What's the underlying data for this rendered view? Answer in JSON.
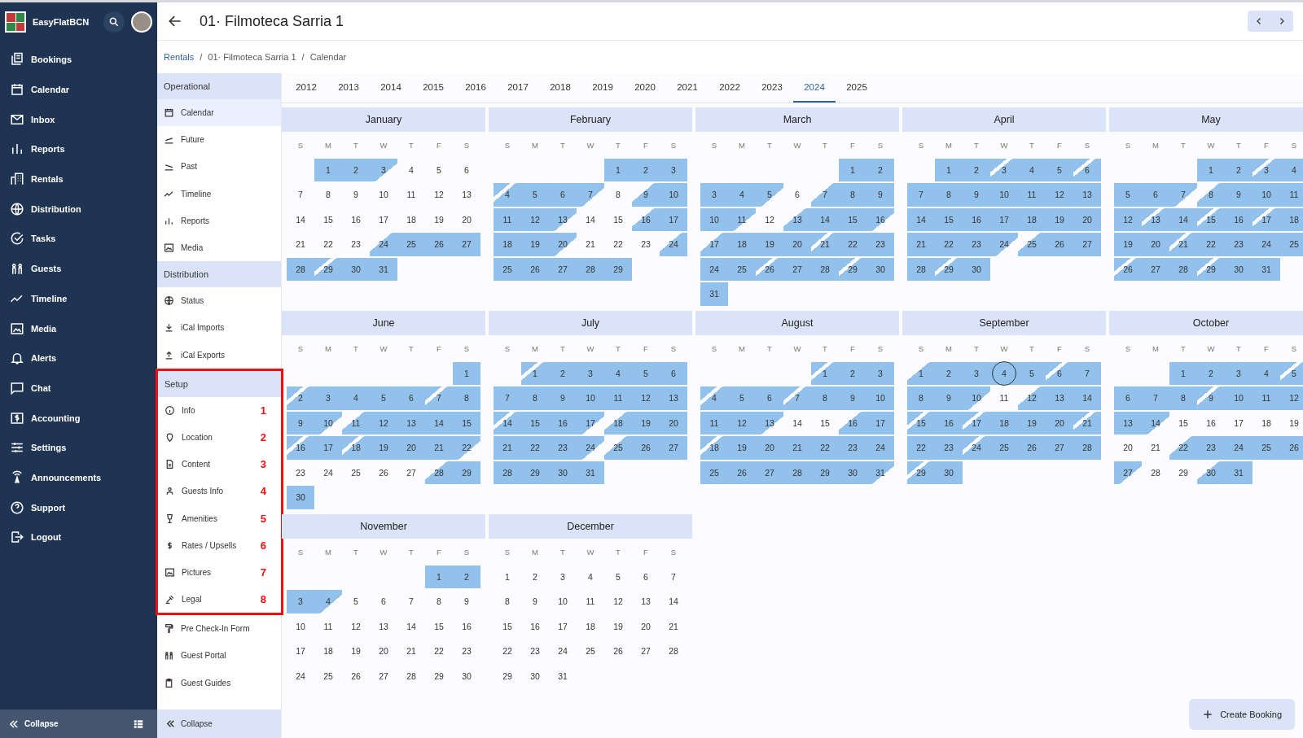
{
  "app": {
    "name": "EasyFlatBCN"
  },
  "header": {
    "title": "01· Filmoteca Sarria 1"
  },
  "breadcrumb": [
    {
      "label": "Rentals",
      "link": true,
      "separator": "/"
    },
    {
      "label": "01· Filmoteca Sarria 1",
      "link": false,
      "separator": "/"
    },
    {
      "label": "Calendar",
      "link": false
    }
  ],
  "main_nav": {
    "items": [
      {
        "label": "Bookings"
      },
      {
        "label": "Calendar"
      },
      {
        "label": "Inbox"
      },
      {
        "label": "Reports"
      },
      {
        "label": "Rentals"
      },
      {
        "label": "Distribution"
      },
      {
        "label": "Tasks"
      },
      {
        "label": "Guests"
      },
      {
        "label": "Timeline"
      },
      {
        "label": "Media"
      },
      {
        "label": "Alerts"
      },
      {
        "label": "Chat"
      },
      {
        "label": "Accounting"
      },
      {
        "label": "Settings"
      },
      {
        "label": "Announcements"
      },
      {
        "label": "Support"
      },
      {
        "label": "Logout"
      }
    ],
    "collapse": "Collapse"
  },
  "sub_nav": {
    "sections": [
      {
        "title": "Operational",
        "annotated": false,
        "items": [
          {
            "label": "Calendar",
            "selected": true
          },
          {
            "label": "Future",
            "selected": false
          },
          {
            "label": "Past",
            "selected": false
          },
          {
            "label": "Timeline",
            "selected": false
          },
          {
            "label": "Reports",
            "selected": false
          },
          {
            "label": "Media",
            "selected": false
          }
        ]
      },
      {
        "title": "Distribution",
        "annotated": false,
        "items": [
          {
            "label": "Status",
            "selected": false
          },
          {
            "label": "iCal Imports",
            "selected": false
          },
          {
            "label": "iCal Exports",
            "selected": false
          }
        ]
      },
      {
        "title": "Setup",
        "annotated": true,
        "items": [
          {
            "label": "Info",
            "selected": false,
            "marker": "1"
          },
          {
            "label": "Location",
            "selected": false,
            "marker": "2"
          },
          {
            "label": "Content",
            "selected": false,
            "marker": "3"
          },
          {
            "label": "Guests Info",
            "selected": false,
            "marker": "4"
          },
          {
            "label": "Amenities",
            "selected": false,
            "marker": "5"
          },
          {
            "label": "Rates / Upsells",
            "selected": false,
            "marker": "6"
          },
          {
            "label": "Pictures",
            "selected": false,
            "marker": "7"
          },
          {
            "label": "Legal",
            "selected": false,
            "marker": "8"
          }
        ]
      },
      {
        "annotated": false,
        "items": [
          {
            "label": "Pre Check-In Form",
            "selected": false
          },
          {
            "label": "Guest Portal",
            "selected": false
          },
          {
            "label": "Guest Guides",
            "selected": false
          }
        ]
      }
    ],
    "collapse": "Collapse"
  },
  "years": [
    {
      "label": "2012",
      "selected": false
    },
    {
      "label": "2013",
      "selected": false
    },
    {
      "label": "2014",
      "selected": false
    },
    {
      "label": "2015",
      "selected": false
    },
    {
      "label": "2016",
      "selected": false
    },
    {
      "label": "2017",
      "selected": false
    },
    {
      "label": "2018",
      "selected": false
    },
    {
      "label": "2019",
      "selected": false
    },
    {
      "label": "2020",
      "selected": false
    },
    {
      "label": "2021",
      "selected": false
    },
    {
      "label": "2022",
      "selected": false
    },
    {
      "label": "2023",
      "selected": false
    },
    {
      "label": "2024",
      "selected": true
    },
    {
      "label": "2025",
      "selected": false
    }
  ],
  "calendar": {
    "months": [
      {
        "name": "January",
        "weekdays": [
          "S",
          "M",
          "T",
          "W",
          "T",
          "F",
          "S"
        ],
        "days": [
          {
            "day": "1",
            "kind": "full"
          },
          {
            "day": "2",
            "kind": "full"
          },
          {
            "day": "3",
            "kind": "out"
          },
          {
            "day": "4",
            "kind": "free"
          },
          {
            "day": "5",
            "kind": "free"
          },
          {
            "day": "6",
            "kind": "free"
          },
          {
            "day": "7",
            "kind": "free"
          },
          {
            "day": "8",
            "kind": "free"
          },
          {
            "day": "9",
            "kind": "free"
          },
          {
            "day": "10",
            "kind": "free"
          },
          {
            "day": "11",
            "kind": "free"
          },
          {
            "day": "12",
            "kind": "free"
          },
          {
            "day": "13",
            "kind": "free"
          },
          {
            "day": "14",
            "kind": "free"
          },
          {
            "day": "15",
            "kind": "free"
          },
          {
            "day": "16",
            "kind": "free"
          },
          {
            "day": "17",
            "kind": "free"
          },
          {
            "day": "18",
            "kind": "free"
          },
          {
            "day": "19",
            "kind": "free"
          },
          {
            "day": "20",
            "kind": "free"
          },
          {
            "day": "21",
            "kind": "free"
          },
          {
            "day": "22",
            "kind": "free"
          },
          {
            "day": "23",
            "kind": "free"
          },
          {
            "day": "24",
            "kind": "in"
          },
          {
            "day": "25",
            "kind": "full"
          },
          {
            "day": "26",
            "kind": "full"
          },
          {
            "day": "27",
            "kind": "full"
          },
          {
            "day": "28",
            "kind": "full"
          },
          {
            "day": "29",
            "kind": "swap"
          },
          {
            "day": "30",
            "kind": "full"
          },
          {
            "day": "31",
            "kind": "full"
          }
        ]
      },
      {
        "name": "February",
        "weekdays": [
          "S",
          "M",
          "T",
          "W",
          "T",
          "F",
          "S"
        ],
        "days": [
          {
            "day": "1",
            "kind": "full"
          },
          {
            "day": "2",
            "kind": "full"
          },
          {
            "day": "3",
            "kind": "full"
          },
          {
            "day": "4",
            "kind": "swap"
          },
          {
            "day": "5",
            "kind": "full"
          },
          {
            "day": "6",
            "kind": "full"
          },
          {
            "day": "7",
            "kind": "out"
          },
          {
            "day": "8",
            "kind": "free"
          },
          {
            "day": "9",
            "kind": "in"
          },
          {
            "day": "10",
            "kind": "full"
          },
          {
            "day": "11",
            "kind": "full"
          },
          {
            "day": "12",
            "kind": "full"
          },
          {
            "day": "13",
            "kind": "out"
          },
          {
            "day": "14",
            "kind": "free"
          },
          {
            "day": "15",
            "kind": "free"
          },
          {
            "day": "16",
            "kind": "in"
          },
          {
            "day": "17",
            "kind": "full"
          },
          {
            "day": "18",
            "kind": "full"
          },
          {
            "day": "19",
            "kind": "full"
          },
          {
            "day": "20",
            "kind": "out"
          },
          {
            "day": "21",
            "kind": "free"
          },
          {
            "day": "22",
            "kind": "free"
          },
          {
            "day": "23",
            "kind": "free"
          },
          {
            "day": "24",
            "kind": "in"
          },
          {
            "day": "25",
            "kind": "full"
          },
          {
            "day": "26",
            "kind": "full"
          },
          {
            "day": "27",
            "kind": "full"
          },
          {
            "day": "28",
            "kind": "full"
          },
          {
            "day": "29",
            "kind": "full"
          }
        ]
      },
      {
        "name": "March",
        "weekdays": [
          "S",
          "M",
          "T",
          "W",
          "T",
          "F",
          "S"
        ],
        "days": [
          {
            "day": "1",
            "kind": "full"
          },
          {
            "day": "2",
            "kind": "full"
          },
          {
            "day": "3",
            "kind": "full"
          },
          {
            "day": "4",
            "kind": "full"
          },
          {
            "day": "5",
            "kind": "out"
          },
          {
            "day": "6",
            "kind": "free"
          },
          {
            "day": "7",
            "kind": "in"
          },
          {
            "day": "8",
            "kind": "full"
          },
          {
            "day": "9",
            "kind": "full"
          },
          {
            "day": "10",
            "kind": "full"
          },
          {
            "day": "11",
            "kind": "out"
          },
          {
            "day": "12",
            "kind": "free"
          },
          {
            "day": "13",
            "kind": "in"
          },
          {
            "day": "14",
            "kind": "full"
          },
          {
            "day": "15",
            "kind": "full"
          },
          {
            "day": "16",
            "kind": "out"
          },
          {
            "day": "17",
            "kind": "in"
          },
          {
            "day": "18",
            "kind": "full"
          },
          {
            "day": "19",
            "kind": "full"
          },
          {
            "day": "20",
            "kind": "full"
          },
          {
            "day": "21",
            "kind": "swap"
          },
          {
            "day": "22",
            "kind": "full"
          },
          {
            "day": "23",
            "kind": "full"
          },
          {
            "day": "24",
            "kind": "full"
          },
          {
            "day": "25",
            "kind": "full"
          },
          {
            "day": "26",
            "kind": "swap"
          },
          {
            "day": "27",
            "kind": "full"
          },
          {
            "day": "28",
            "kind": "full"
          },
          {
            "day": "29",
            "kind": "swap"
          },
          {
            "day": "30",
            "kind": "full"
          },
          {
            "day": "31",
            "kind": "full"
          }
        ]
      },
      {
        "name": "April",
        "weekdays": [
          "S",
          "M",
          "T",
          "W",
          "T",
          "F",
          "S"
        ],
        "days": [
          {
            "day": "1",
            "kind": "full"
          },
          {
            "day": "2",
            "kind": "full"
          },
          {
            "day": "3",
            "kind": "swap"
          },
          {
            "day": "4",
            "kind": "full"
          },
          {
            "day": "5",
            "kind": "full"
          },
          {
            "day": "6",
            "kind": "swap"
          },
          {
            "day": "7",
            "kind": "full"
          },
          {
            "day": "8",
            "kind": "full"
          },
          {
            "day": "9",
            "kind": "full"
          },
          {
            "day": "10",
            "kind": "full"
          },
          {
            "day": "11",
            "kind": "full"
          },
          {
            "day": "12",
            "kind": "full"
          },
          {
            "day": "13",
            "kind": "full"
          },
          {
            "day": "14",
            "kind": "full"
          },
          {
            "day": "15",
            "kind": "full"
          },
          {
            "day": "16",
            "kind": "full"
          },
          {
            "day": "17",
            "kind": "full"
          },
          {
            "day": "18",
            "kind": "full"
          },
          {
            "day": "19",
            "kind": "full"
          },
          {
            "day": "20",
            "kind": "full"
          },
          {
            "day": "21",
            "kind": "full"
          },
          {
            "day": "22",
            "kind": "full"
          },
          {
            "day": "23",
            "kind": "full"
          },
          {
            "day": "24",
            "kind": "out"
          },
          {
            "day": "25",
            "kind": "in"
          },
          {
            "day": "26",
            "kind": "full"
          },
          {
            "day": "27",
            "kind": "full"
          },
          {
            "day": "28",
            "kind": "full"
          },
          {
            "day": "29",
            "kind": "swap"
          },
          {
            "day": "30",
            "kind": "full"
          }
        ]
      },
      {
        "name": "May",
        "weekdays": [
          "S",
          "M",
          "T",
          "W",
          "T",
          "F",
          "S"
        ],
        "days": [
          {
            "day": "1",
            "kind": "full"
          },
          {
            "day": "2",
            "kind": "full"
          },
          {
            "day": "3",
            "kind": "swap"
          },
          {
            "day": "4",
            "kind": "full"
          },
          {
            "day": "5",
            "kind": "full"
          },
          {
            "day": "6",
            "kind": "full"
          },
          {
            "day": "7",
            "kind": "out"
          },
          {
            "day": "8",
            "kind": "in"
          },
          {
            "day": "9",
            "kind": "full"
          },
          {
            "day": "10",
            "kind": "full"
          },
          {
            "day": "11",
            "kind": "full"
          },
          {
            "day": "12",
            "kind": "full"
          },
          {
            "day": "13",
            "kind": "swap"
          },
          {
            "day": "14",
            "kind": "full"
          },
          {
            "day": "15",
            "kind": "swap"
          },
          {
            "day": "16",
            "kind": "full"
          },
          {
            "day": "17",
            "kind": "swap"
          },
          {
            "day": "18",
            "kind": "full"
          },
          {
            "day": "19",
            "kind": "full"
          },
          {
            "day": "20",
            "kind": "full"
          },
          {
            "day": "21",
            "kind": "swap"
          },
          {
            "day": "22",
            "kind": "full"
          },
          {
            "day": "23",
            "kind": "full"
          },
          {
            "day": "24",
            "kind": "full"
          },
          {
            "day": "25",
            "kind": "full"
          },
          {
            "day": "26",
            "kind": "swap"
          },
          {
            "day": "27",
            "kind": "full"
          },
          {
            "day": "28",
            "kind": "full"
          },
          {
            "day": "29",
            "kind": "swap"
          },
          {
            "day": "30",
            "kind": "full"
          },
          {
            "day": "31",
            "kind": "full"
          }
        ]
      },
      {
        "name": "June",
        "weekdays": [
          "S",
          "M",
          "T",
          "W",
          "T",
          "F",
          "S"
        ],
        "days": [
          {
            "day": "1",
            "kind": "full"
          },
          {
            "day": "2",
            "kind": "swap"
          },
          {
            "day": "3",
            "kind": "full"
          },
          {
            "day": "4",
            "kind": "full"
          },
          {
            "day": "5",
            "kind": "full"
          },
          {
            "day": "6",
            "kind": "full"
          },
          {
            "day": "7",
            "kind": "swap"
          },
          {
            "day": "8",
            "kind": "full"
          },
          {
            "day": "9",
            "kind": "full"
          },
          {
            "day": "10",
            "kind": "out"
          },
          {
            "day": "11",
            "kind": "in"
          },
          {
            "day": "12",
            "kind": "full"
          },
          {
            "day": "13",
            "kind": "full"
          },
          {
            "day": "14",
            "kind": "full"
          },
          {
            "day": "15",
            "kind": "full"
          },
          {
            "day": "16",
            "kind": "swap"
          },
          {
            "day": "17",
            "kind": "full"
          },
          {
            "day": "18",
            "kind": "swap"
          },
          {
            "day": "19",
            "kind": "full"
          },
          {
            "day": "20",
            "kind": "full"
          },
          {
            "day": "21",
            "kind": "full"
          },
          {
            "day": "22",
            "kind": "out"
          },
          {
            "day": "23",
            "kind": "free"
          },
          {
            "day": "24",
            "kind": "free"
          },
          {
            "day": "25",
            "kind": "free"
          },
          {
            "day": "26",
            "kind": "free"
          },
          {
            "day": "27",
            "kind": "free"
          },
          {
            "day": "28",
            "kind": "in"
          },
          {
            "day": "29",
            "kind": "full"
          },
          {
            "day": "30",
            "kind": "full"
          }
        ]
      },
      {
        "name": "July",
        "weekdays": [
          "S",
          "M",
          "T",
          "W",
          "T",
          "F",
          "S"
        ],
        "days": [
          {
            "day": "1",
            "kind": "swap"
          },
          {
            "day": "2",
            "kind": "full"
          },
          {
            "day": "3",
            "kind": "full"
          },
          {
            "day": "4",
            "kind": "full"
          },
          {
            "day": "5",
            "kind": "full"
          },
          {
            "day": "6",
            "kind": "full"
          },
          {
            "day": "7",
            "kind": "full"
          },
          {
            "day": "8",
            "kind": "full"
          },
          {
            "day": "9",
            "kind": "full"
          },
          {
            "day": "10",
            "kind": "full"
          },
          {
            "day": "11",
            "kind": "full"
          },
          {
            "day": "12",
            "kind": "full"
          },
          {
            "day": "13",
            "kind": "full"
          },
          {
            "day": "14",
            "kind": "swap"
          },
          {
            "day": "15",
            "kind": "full"
          },
          {
            "day": "16",
            "kind": "full"
          },
          {
            "day": "17",
            "kind": "out"
          },
          {
            "day": "18",
            "kind": "in"
          },
          {
            "day": "19",
            "kind": "full"
          },
          {
            "day": "20",
            "kind": "full"
          },
          {
            "day": "21",
            "kind": "full"
          },
          {
            "day": "22",
            "kind": "full"
          },
          {
            "day": "23",
            "kind": "full"
          },
          {
            "day": "24",
            "kind": "out"
          },
          {
            "day": "25",
            "kind": "in"
          },
          {
            "day": "26",
            "kind": "full"
          },
          {
            "day": "27",
            "kind": "full"
          },
          {
            "day": "28",
            "kind": "full"
          },
          {
            "day": "29",
            "kind": "full"
          },
          {
            "day": "30",
            "kind": "full"
          },
          {
            "day": "31",
            "kind": "full"
          }
        ]
      },
      {
        "name": "August",
        "weekdays": [
          "S",
          "M",
          "T",
          "W",
          "T",
          "F",
          "S"
        ],
        "days": [
          {
            "day": "1",
            "kind": "swap"
          },
          {
            "day": "2",
            "kind": "full"
          },
          {
            "day": "3",
            "kind": "full"
          },
          {
            "day": "4",
            "kind": "swap"
          },
          {
            "day": "5",
            "kind": "full"
          },
          {
            "day": "6",
            "kind": "full"
          },
          {
            "day": "7",
            "kind": "swap"
          },
          {
            "day": "8",
            "kind": "full"
          },
          {
            "day": "9",
            "kind": "full"
          },
          {
            "day": "10",
            "kind": "full"
          },
          {
            "day": "11",
            "kind": "full"
          },
          {
            "day": "12",
            "kind": "full"
          },
          {
            "day": "13",
            "kind": "out"
          },
          {
            "day": "14",
            "kind": "free"
          },
          {
            "day": "15",
            "kind": "free"
          },
          {
            "day": "16",
            "kind": "in"
          },
          {
            "day": "17",
            "kind": "full"
          },
          {
            "day": "18",
            "kind": "swap"
          },
          {
            "day": "19",
            "kind": "full"
          },
          {
            "day": "20",
            "kind": "full"
          },
          {
            "day": "21",
            "kind": "full"
          },
          {
            "day": "22",
            "kind": "full"
          },
          {
            "day": "23",
            "kind": "full"
          },
          {
            "day": "24",
            "kind": "full"
          },
          {
            "day": "25",
            "kind": "full"
          },
          {
            "day": "26",
            "kind": "full"
          },
          {
            "day": "27",
            "kind": "full"
          },
          {
            "day": "28",
            "kind": "full"
          },
          {
            "day": "29",
            "kind": "full"
          },
          {
            "day": "30",
            "kind": "full"
          },
          {
            "day": "31",
            "kind": "out"
          }
        ]
      },
      {
        "name": "September",
        "weekdays": [
          "S",
          "M",
          "T",
          "W",
          "T",
          "F",
          "S"
        ],
        "days": [
          {
            "day": "1",
            "kind": "in"
          },
          {
            "day": "2",
            "kind": "full"
          },
          {
            "day": "3",
            "kind": "full"
          },
          {
            "day": "4",
            "kind": "full",
            "today": true
          },
          {
            "day": "5",
            "kind": "full"
          },
          {
            "day": "6",
            "kind": "swap"
          },
          {
            "day": "7",
            "kind": "full"
          },
          {
            "day": "8",
            "kind": "full"
          },
          {
            "day": "9",
            "kind": "full"
          },
          {
            "day": "10",
            "kind": "out"
          },
          {
            "day": "11",
            "kind": "free"
          },
          {
            "day": "12",
            "kind": "in"
          },
          {
            "day": "13",
            "kind": "full"
          },
          {
            "day": "14",
            "kind": "full"
          },
          {
            "day": "15",
            "kind": "swap"
          },
          {
            "day": "16",
            "kind": "full"
          },
          {
            "day": "17",
            "kind": "swap"
          },
          {
            "day": "18",
            "kind": "full"
          },
          {
            "day": "19",
            "kind": "full"
          },
          {
            "day": "20",
            "kind": "full"
          },
          {
            "day": "21",
            "kind": "swap"
          },
          {
            "day": "22",
            "kind": "full"
          },
          {
            "day": "23",
            "kind": "full"
          },
          {
            "day": "24",
            "kind": "swap"
          },
          {
            "day": "25",
            "kind": "full"
          },
          {
            "day": "26",
            "kind": "full"
          },
          {
            "day": "27",
            "kind": "full"
          },
          {
            "day": "28",
            "kind": "full"
          },
          {
            "day": "29",
            "kind": "swap"
          },
          {
            "day": "30",
            "kind": "full"
          }
        ]
      },
      {
        "name": "October",
        "weekdays": [
          "S",
          "M",
          "T",
          "W",
          "T",
          "F",
          "S"
        ],
        "days": [
          {
            "day": "1",
            "kind": "full"
          },
          {
            "day": "2",
            "kind": "full"
          },
          {
            "day": "3",
            "kind": "full"
          },
          {
            "day": "4",
            "kind": "full"
          },
          {
            "day": "5",
            "kind": "swap"
          },
          {
            "day": "6",
            "kind": "full"
          },
          {
            "day": "7",
            "kind": "full"
          },
          {
            "day": "8",
            "kind": "full"
          },
          {
            "day": "9",
            "kind": "swap"
          },
          {
            "day": "10",
            "kind": "full"
          },
          {
            "day": "11",
            "kind": "full"
          },
          {
            "day": "12",
            "kind": "full"
          },
          {
            "day": "13",
            "kind": "full"
          },
          {
            "day": "14",
            "kind": "out"
          },
          {
            "day": "15",
            "kind": "free"
          },
          {
            "day": "16",
            "kind": "free"
          },
          {
            "day": "17",
            "kind": "free"
          },
          {
            "day": "18",
            "kind": "free"
          },
          {
            "day": "19",
            "kind": "free"
          },
          {
            "day": "20",
            "kind": "free"
          },
          {
            "day": "21",
            "kind": "free"
          },
          {
            "day": "22",
            "kind": "in"
          },
          {
            "day": "23",
            "kind": "full"
          },
          {
            "day": "24",
            "kind": "full"
          },
          {
            "day": "25",
            "kind": "full"
          },
          {
            "day": "26",
            "kind": "full"
          },
          {
            "day": "27",
            "kind": "out"
          },
          {
            "day": "28",
            "kind": "free"
          },
          {
            "day": "29",
            "kind": "free"
          },
          {
            "day": "30",
            "kind": "in"
          },
          {
            "day": "31",
            "kind": "full"
          }
        ]
      },
      {
        "name": "November",
        "weekdays": [
          "S",
          "M",
          "T",
          "W",
          "T",
          "F",
          "S"
        ],
        "days": [
          {
            "day": "1",
            "kind": "full"
          },
          {
            "day": "2",
            "kind": "full"
          },
          {
            "day": "3",
            "kind": "full"
          },
          {
            "day": "4",
            "kind": "out"
          },
          {
            "day": "5",
            "kind": "free"
          },
          {
            "day": "6",
            "kind": "free"
          },
          {
            "day": "7",
            "kind": "free"
          },
          {
            "day": "8",
            "kind": "free"
          },
          {
            "day": "9",
            "kind": "free"
          },
          {
            "day": "10",
            "kind": "free"
          },
          {
            "day": "11",
            "kind": "free"
          },
          {
            "day": "12",
            "kind": "free"
          },
          {
            "day": "13",
            "kind": "free"
          },
          {
            "day": "14",
            "kind": "free"
          },
          {
            "day": "15",
            "kind": "free"
          },
          {
            "day": "16",
            "kind": "free"
          },
          {
            "day": "17",
            "kind": "free"
          },
          {
            "day": "18",
            "kind": "free"
          },
          {
            "day": "19",
            "kind": "free"
          },
          {
            "day": "20",
            "kind": "free"
          },
          {
            "day": "21",
            "kind": "free"
          },
          {
            "day": "22",
            "kind": "free"
          },
          {
            "day": "23",
            "kind": "free"
          },
          {
            "day": "24",
            "kind": "free"
          },
          {
            "day": "25",
            "kind": "free"
          },
          {
            "day": "26",
            "kind": "free"
          },
          {
            "day": "27",
            "kind": "free"
          },
          {
            "day": "28",
            "kind": "free"
          },
          {
            "day": "29",
            "kind": "free"
          },
          {
            "day": "30",
            "kind": "free"
          }
        ]
      },
      {
        "name": "December",
        "weekdays": [
          "S",
          "M",
          "T",
          "W",
          "T",
          "F",
          "S"
        ],
        "days": [
          {
            "day": "1",
            "kind": "free"
          },
          {
            "day": "2",
            "kind": "free"
          },
          {
            "day": "3",
            "kind": "free"
          },
          {
            "day": "4",
            "kind": "free"
          },
          {
            "day": "5",
            "kind": "free"
          },
          {
            "day": "6",
            "kind": "free"
          },
          {
            "day": "7",
            "kind": "free"
          },
          {
            "day": "8",
            "kind": "free"
          },
          {
            "day": "9",
            "kind": "free"
          },
          {
            "day": "10",
            "kind": "free"
          },
          {
            "day": "11",
            "kind": "free"
          },
          {
            "day": "12",
            "kind": "free"
          },
          {
            "day": "13",
            "kind": "free"
          },
          {
            "day": "14",
            "kind": "free"
          },
          {
            "day": "15",
            "kind": "free"
          },
          {
            "day": "16",
            "kind": "free"
          },
          {
            "day": "17",
            "kind": "free"
          },
          {
            "day": "18",
            "kind": "free"
          },
          {
            "day": "19",
            "kind": "free"
          },
          {
            "day": "20",
            "kind": "free"
          },
          {
            "day": "21",
            "kind": "free"
          },
          {
            "day": "22",
            "kind": "free"
          },
          {
            "day": "23",
            "kind": "free"
          },
          {
            "day": "24",
            "kind": "free"
          },
          {
            "day": "25",
            "kind": "free"
          },
          {
            "day": "26",
            "kind": "free"
          },
          {
            "day": "27",
            "kind": "free"
          },
          {
            "day": "28",
            "kind": "free"
          },
          {
            "day": "29",
            "kind": "free"
          },
          {
            "day": "30",
            "kind": "free"
          },
          {
            "day": "31",
            "kind": "free"
          }
        ]
      }
    ]
  },
  "create_booking": {
    "label": "Create Booking"
  }
}
